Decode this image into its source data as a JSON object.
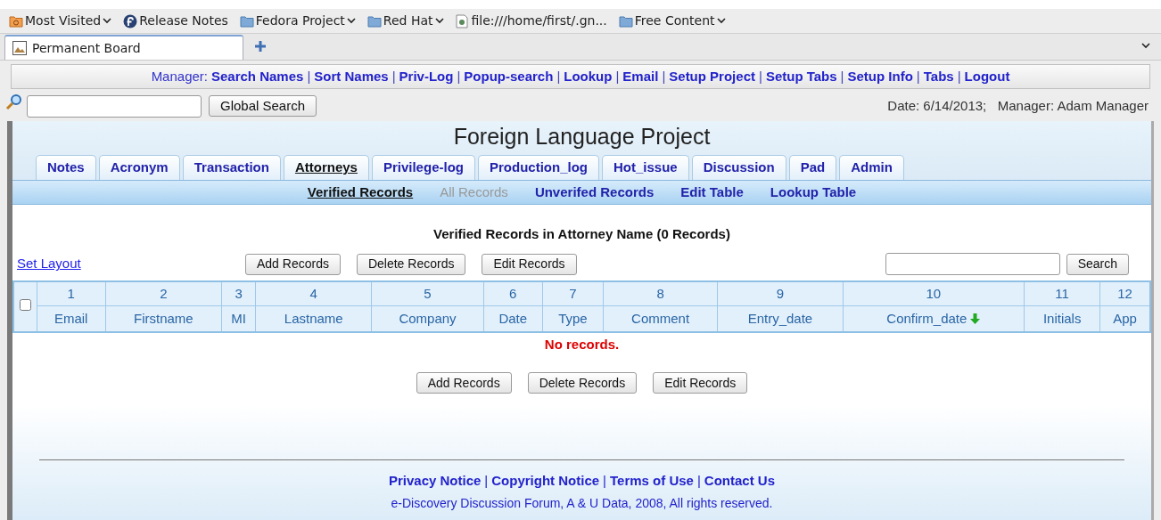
{
  "bookmarks": [
    {
      "label": "Most Visited",
      "kind": "special",
      "dropdown": true
    },
    {
      "label": "Release Notes",
      "kind": "logo",
      "dropdown": false
    },
    {
      "label": "Fedora Project",
      "kind": "folder",
      "dropdown": true
    },
    {
      "label": "Red Hat",
      "kind": "folder",
      "dropdown": true
    },
    {
      "label": "file:///home/first/.gn...",
      "kind": "file",
      "dropdown": false
    },
    {
      "label": "Free Content",
      "kind": "folder",
      "dropdown": true
    }
  ],
  "browser_tabs": [
    {
      "label": "Permanent Board",
      "selected": true
    }
  ],
  "manager_bar": {
    "label": "Manager:",
    "separator": "|",
    "links": [
      "Search Names",
      "Sort Names",
      "Priv-Log",
      "Popup-search",
      "Lookup",
      "Email",
      "Setup Project",
      "Setup Tabs",
      "Setup Info",
      "Tabs",
      "Logout"
    ]
  },
  "global_search": {
    "button": "Global Search",
    "info": "Date: 6/14/2013;   Manager: Adam Manager"
  },
  "project_title": "Foreign Language Project",
  "tabs": [
    {
      "label": "Notes",
      "selected": false
    },
    {
      "label": "Acronym",
      "selected": false
    },
    {
      "label": "Transaction",
      "selected": false
    },
    {
      "label": "Attorneys",
      "selected": true
    },
    {
      "label": "Privilege-log",
      "selected": false
    },
    {
      "label": "Production_log",
      "selected": false
    },
    {
      "label": "Hot_issue",
      "selected": false
    },
    {
      "label": "Discussion",
      "selected": false
    },
    {
      "label": "Pad",
      "selected": false
    },
    {
      "label": "Admin",
      "selected": false
    }
  ],
  "subnav": [
    {
      "label": "Verified Records",
      "selected": true,
      "disabled": false
    },
    {
      "label": "All Records",
      "selected": false,
      "disabled": true
    },
    {
      "label": "Unverifed Records",
      "selected": false,
      "disabled": false
    },
    {
      "label": "Edit Table",
      "selected": false,
      "disabled": false
    },
    {
      "label": "Lookup Table",
      "selected": false,
      "disabled": false
    }
  ],
  "heading": "Verified Records in Attorney Name (0 Records)",
  "set_layout": "Set Layout",
  "actions": [
    "Add Records",
    "Delete Records",
    "Edit Records"
  ],
  "search_button": "Search",
  "table": {
    "select_all_checked": false,
    "columns": [
      {
        "number": "1",
        "name": "Email",
        "sorted": false
      },
      {
        "number": "2",
        "name": "Firstname",
        "sorted": false
      },
      {
        "number": "3",
        "name": "MI",
        "sorted": false
      },
      {
        "number": "4",
        "name": "Lastname",
        "sorted": false
      },
      {
        "number": "5",
        "name": "Company",
        "sorted": false
      },
      {
        "number": "6",
        "name": "Date",
        "sorted": false
      },
      {
        "number": "7",
        "name": "Type",
        "sorted": false
      },
      {
        "number": "8",
        "name": "Comment",
        "sorted": false
      },
      {
        "number": "9",
        "name": "Entry_date",
        "sorted": false
      },
      {
        "number": "10",
        "name": "Confirm_date",
        "sorted": true
      },
      {
        "number": "11",
        "name": "Initials",
        "sorted": false
      },
      {
        "number": "12",
        "name": "App",
        "sorted": false
      }
    ],
    "empty_message": "No records."
  },
  "bottom_actions": [
    "Add Records",
    "Delete Records",
    "Edit Records"
  ],
  "footer": {
    "separator": "|",
    "links": [
      "Privacy Notice",
      "Copyright Notice",
      "Terms of Use",
      "Contact Us"
    ],
    "copyright": "e-Discovery Discussion Forum, A & U Data, 2008, All rights reserved."
  }
}
